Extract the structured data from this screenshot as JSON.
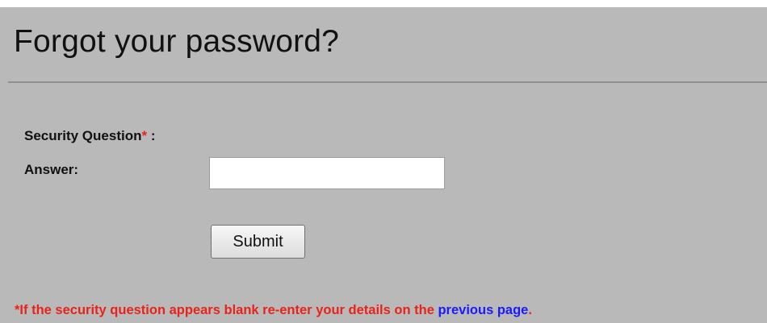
{
  "form": {
    "title": "Forgot your password?",
    "security_question_label": "Security Question",
    "required_marker": "*",
    "security_question_suffix": " :",
    "security_question_value": "",
    "answer_label": "Answer:",
    "answer_value": "",
    "submit_label": "Submit"
  },
  "footer_note": {
    "text": "*If the security question appears blank re-enter your details on the ",
    "link_text": "previous page",
    "end": "."
  },
  "colors": {
    "background": "#b9b9b9",
    "required": "#e8231b",
    "link": "#1a1aff"
  }
}
